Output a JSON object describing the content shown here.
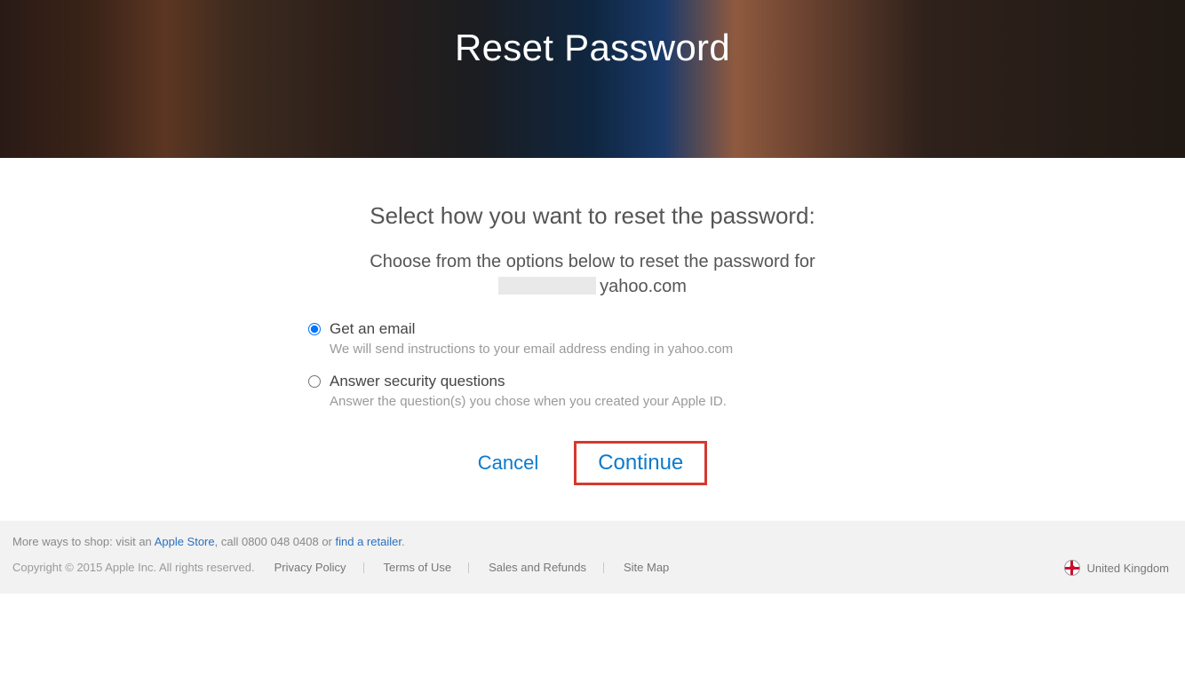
{
  "hero": {
    "title": "Reset Password"
  },
  "main": {
    "prompt": "Select how you want to reset the password:",
    "sub": "Choose from the options below to reset the password for",
    "email_suffix": "yahoo.com"
  },
  "options": [
    {
      "label": "Get an email",
      "desc": "We will send instructions to your email address ending in yahoo.com",
      "selected": true
    },
    {
      "label": "Answer security questions",
      "desc": "Answer the question(s) you chose when you created your Apple ID.",
      "selected": false
    }
  ],
  "actions": {
    "cancel": "Cancel",
    "continue": "Continue"
  },
  "footer": {
    "more_ways_pre": "More ways to shop: visit an ",
    "apple_store": "Apple Store",
    "more_ways_mid": ", call 0800 048 0408 or ",
    "find_retailer": "find a retailer",
    "more_ways_post": ".",
    "copyright": "Copyright © 2015 Apple Inc. All rights reserved.",
    "links": [
      "Privacy Policy",
      "Terms of Use",
      "Sales and Refunds",
      "Site Map"
    ],
    "region": "United Kingdom"
  }
}
